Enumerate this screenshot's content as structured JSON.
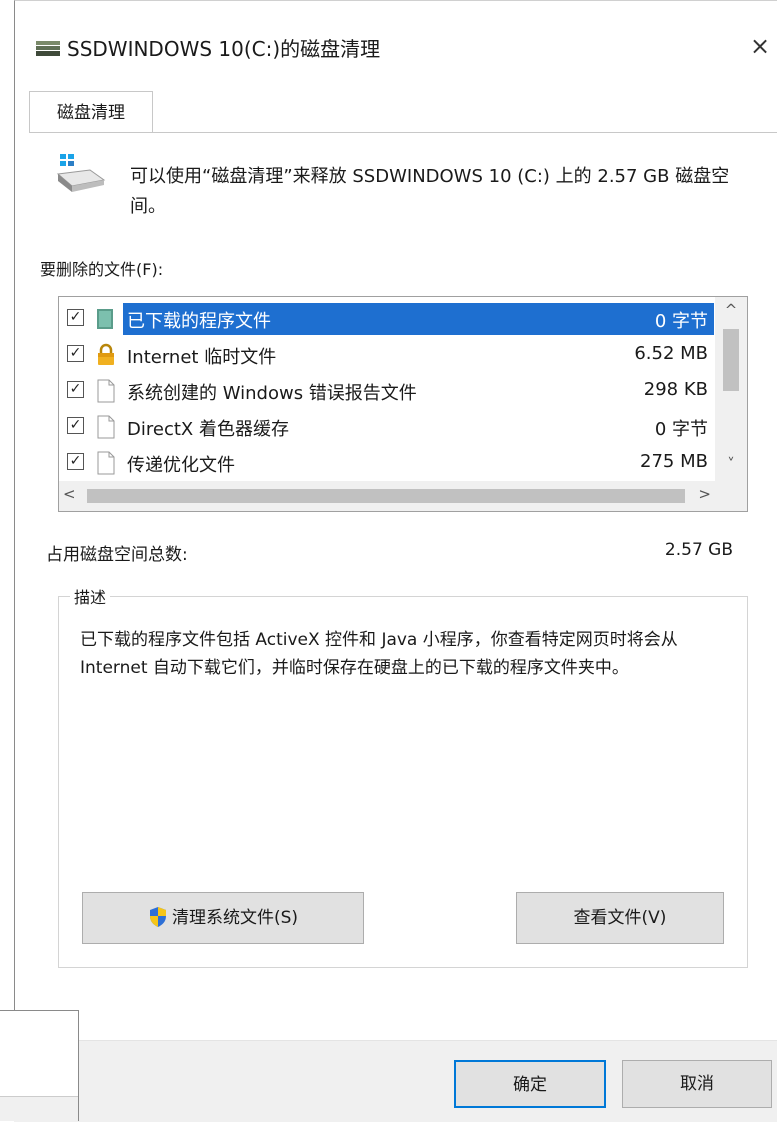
{
  "window": {
    "title": "SSDWINDOWS 10(C:)的磁盘清理",
    "close_symbol": "×"
  },
  "tabs": [
    {
      "label": "磁盘清理",
      "active": true
    }
  ],
  "info": {
    "icon": "drive-icon",
    "text": "可以使用“磁盘清理”来释放 SSDWINDOWS 10 (C:) 上的 2.57 GB 磁盘空间。"
  },
  "files_label": "要删除的文件(F):",
  "files": [
    {
      "checked": true,
      "icon": "program-files-icon",
      "name": "已下载的程序文件",
      "size": "0 字节",
      "selected": true
    },
    {
      "checked": true,
      "icon": "lock-icon",
      "name": "Internet 临时文件",
      "size": "6.52 MB",
      "selected": false
    },
    {
      "checked": true,
      "icon": "document-icon",
      "name": "系统创建的 Windows 错误报告文件",
      "size": "298 KB",
      "selected": false
    },
    {
      "checked": true,
      "icon": "document-icon",
      "name": "DirectX 着色器缓存",
      "size": "0 字节",
      "selected": false
    },
    {
      "checked": true,
      "icon": "document-icon",
      "name": "传递优化文件",
      "size": "275 MB",
      "selected": false
    }
  ],
  "scroll": {
    "up": "^",
    "down": "˅",
    "left": "<",
    "right": ">"
  },
  "total": {
    "label": "占用磁盘空间总数:",
    "value": "2.57 GB"
  },
  "description": {
    "legend": "描述",
    "text": "已下载的程序文件包括 ActiveX 控件和 Java 小程序，你查看特定网页时将会从 Internet 自动下载它们，并临时保存在硬盘上的已下载的程序文件夹中。"
  },
  "buttons": {
    "cleanup_system": "清理系统文件(S)",
    "view_files": "查看文件(V)",
    "ok": "确定",
    "cancel": "取消"
  },
  "colors": {
    "selection": "#1e6fd0",
    "default_button_border": "#0078d7"
  }
}
